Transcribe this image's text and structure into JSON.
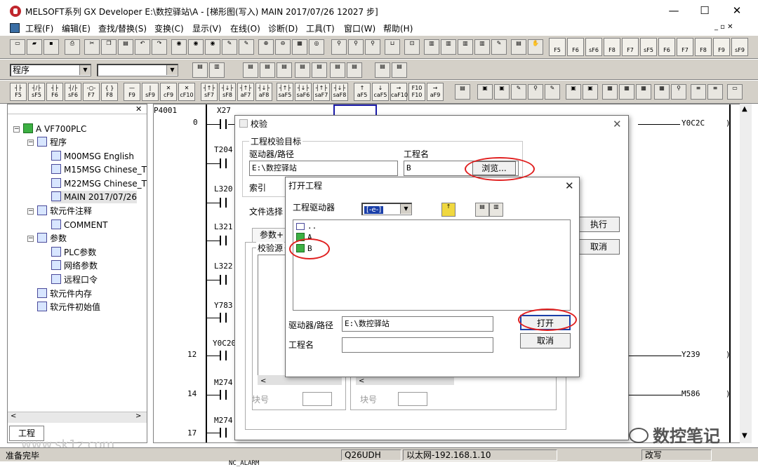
{
  "window": {
    "title": "MELSOFT系列 GX Developer E:\\数控驿站\\A - [梯形图(写入)    MAIN 2017/07/26    12027 步]",
    "controls": [
      "—",
      "☐",
      "✕"
    ]
  },
  "menu": [
    "工程(F)",
    "编辑(E)",
    "查找/替换(S)",
    "变换(C)",
    "显示(V)",
    "在线(O)",
    "诊断(D)",
    "工具(T)",
    "窗口(W)",
    "帮助(H)"
  ],
  "toolbar2": {
    "combo1": "程序",
    "combo2": ""
  },
  "fkeys": [
    {
      "top": "┤├",
      "bot": "F5"
    },
    {
      "top": "┤/├",
      "bot": "sF5"
    },
    {
      "top": "┤├",
      "bot": "F6"
    },
    {
      "top": "┤/├",
      "bot": "sF6"
    },
    {
      "top": "-○-",
      "bot": "F7"
    },
    {
      "top": "{ }",
      "bot": "F8"
    },
    {
      "top": "—",
      "bot": "F9"
    },
    {
      "top": "|",
      "bot": "sF9"
    },
    {
      "top": "✕",
      "bot": "cF9"
    },
    {
      "top": "✕",
      "bot": "cF10"
    },
    {
      "top": "┤↑├",
      "bot": "sF7"
    },
    {
      "top": "┤↓├",
      "bot": "sF8"
    },
    {
      "top": "┤↑├",
      "bot": "aF7"
    },
    {
      "top": "┤↓├",
      "bot": "aF8"
    },
    {
      "top": "┤↑├",
      "bot": "saF5"
    },
    {
      "top": "┤↓├",
      "bot": "saF6"
    },
    {
      "top": "┤↑├",
      "bot": "saF7"
    },
    {
      "top": "┤↓├",
      "bot": "saF8"
    },
    {
      "top": "↑",
      "bot": "aF5"
    },
    {
      "top": "↓",
      "bot": "caF5"
    },
    {
      "top": "→",
      "bot": "caF10"
    },
    {
      "top": "F10",
      "bot": "F10"
    },
    {
      "top": "→",
      "bot": "aF9"
    }
  ],
  "rightkeys": [
    "F5",
    "F6",
    "sF6",
    "F8",
    "F7",
    "sF5",
    "F6",
    "F7",
    "F8",
    "F9",
    "sF9"
  ],
  "project_tree": {
    "root": "A VF700PLC",
    "items": [
      {
        "label": "程序",
        "level": 1
      },
      {
        "label": "M00MSG English",
        "level": 2
      },
      {
        "label": "M15MSG Chinese_T",
        "level": 2
      },
      {
        "label": "M22MSG Chinese_T",
        "level": 2
      },
      {
        "label": "MAIN 2017/07/26",
        "level": 2
      },
      {
        "label": "软元件注释",
        "level": 1
      },
      {
        "label": "COMMENT",
        "level": 2
      },
      {
        "label": "参数",
        "level": 1
      },
      {
        "label": "PLC参数",
        "level": 2
      },
      {
        "label": "网络参数",
        "level": 2
      },
      {
        "label": "远程口令",
        "level": 2
      },
      {
        "label": "软元件内存",
        "level": 1
      },
      {
        "label": "软元件初始值",
        "level": 1
      }
    ],
    "tab": "工程"
  },
  "ladder": {
    "header": "P4001",
    "step_numbers": [
      "0",
      "12",
      "14",
      "17"
    ],
    "devices": [
      "X27",
      "T204",
      "L320",
      "L321",
      "L322",
      "Y783",
      "Y0C20",
      "M274",
      "M274"
    ],
    "coils": [
      "Y0C2C",
      "Y239",
      "M586"
    ],
    "bottom_label": "NC_ALARM"
  },
  "verify_dialog": {
    "title": "校验",
    "group_title": "工程校验目标",
    "drive_label": "驱动器/路径",
    "drive_value": "E:\\数控驿站",
    "project_label": "工程名",
    "project_value": "B",
    "browse_button": "浏览...",
    "index_label": "索引",
    "file_select_label": "文件选择",
    "tab_label": "参数+",
    "source_label": "校验源",
    "execute_button": "执行",
    "cancel_button": "取消",
    "block_label_1": "块号",
    "block_label_2": "块号"
  },
  "open_dialog": {
    "title": "打开工程",
    "drive_label": "工程驱动器",
    "drive_value": "[-e-]",
    "list_items": [
      "..",
      "A",
      "B"
    ],
    "path_label": "驱动器/路径",
    "path_value": "E:\\数控驿站",
    "name_label": "工程名",
    "name_value": "",
    "open_button": "打开",
    "cancel_button": "取消"
  },
  "statusbar": {
    "ready": "准备完毕",
    "cpu": "Q26UDH",
    "connection": "以太网-192.168.1.10",
    "mode": "改写"
  },
  "watermarks": {
    "left": "www.sk1z.com",
    "right": "数控笔记"
  },
  "colors": {
    "highlight_oval": "#e02020",
    "folder_green": "#3cb043"
  }
}
